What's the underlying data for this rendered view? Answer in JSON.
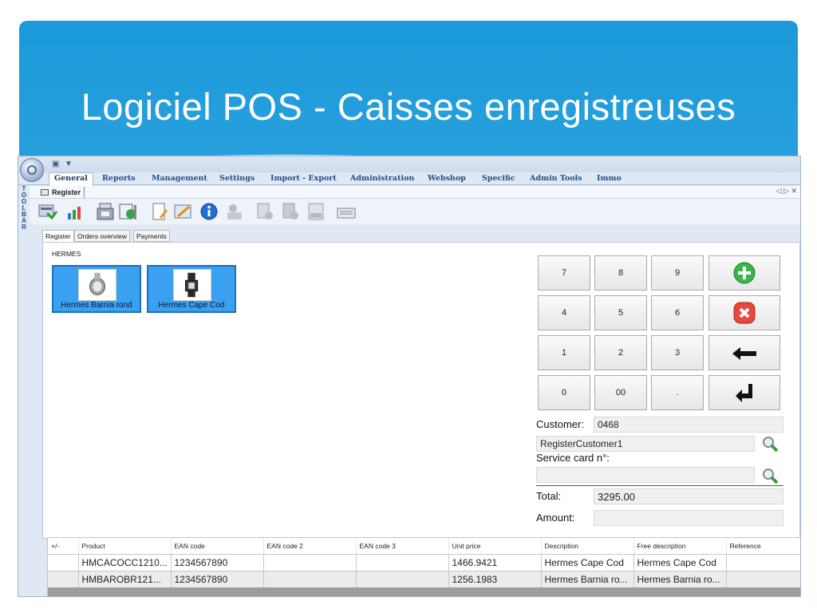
{
  "slide": {
    "title": "Logiciel POS - Caisses enregistreuses"
  },
  "ribbon": {
    "tabs": [
      "General",
      "Reports",
      "Management",
      "Settings",
      "Import - Export",
      "Administration",
      "Webshop",
      "Specific",
      "Admin Tools",
      "Immo"
    ],
    "active_tab": "General"
  },
  "toolbar_side": [
    "T",
    "O",
    "O",
    "L",
    "B",
    "A",
    "R"
  ],
  "document_tab": {
    "label": "Register",
    "controls": "◁ ▷ ✕"
  },
  "icons": [
    "register-icon",
    "stats-icon",
    "cash-register-icon",
    "refresh-report-icon",
    "new-document-icon",
    "edit-icon",
    "info-icon",
    "user-card-icon",
    "add-document-icon",
    "add-book-icon",
    "xlsx-export-icon",
    "keyboard-icon"
  ],
  "inner_tabs": [
    "Register",
    "Orders overview",
    "Payments"
  ],
  "category": "HERMES",
  "products": [
    {
      "label": "Hermes Barnia rond"
    },
    {
      "label": "Hermes Cape Cod"
    }
  ],
  "keypad": {
    "rows": [
      [
        "7",
        "8",
        "9"
      ],
      [
        "4",
        "5",
        "6"
      ],
      [
        "1",
        "2",
        "3"
      ],
      [
        "0",
        "00",
        "."
      ]
    ],
    "actions": [
      "add-icon",
      "cancel-icon",
      "backspace-icon",
      "enter-icon"
    ]
  },
  "customer": {
    "label": "Customer:",
    "number": "0468",
    "name": "RegisterCustomer1",
    "service_card_label": "Service card n°:",
    "service_card_value": ""
  },
  "totals": {
    "total_label": "Total:",
    "total_value": "3295.00",
    "amount_label": "Amount:",
    "amount_value": ""
  },
  "grid": {
    "columns": [
      "+/-",
      "Product",
      "EAN code",
      "EAN code 2",
      "EAN code 3",
      "Unit price",
      "Description",
      "Free description",
      "Reference"
    ],
    "rows": [
      [
        "",
        "HMCACOCC1210...",
        "1234567890",
        "",
        "",
        "1466.9421",
        "Hermes Cape Cod",
        "Hermes Cape Cod",
        ""
      ],
      [
        "",
        "HMBAROBR121...",
        "1234567890",
        "",
        "",
        "1256.1983",
        "Hermes Barnia ro...",
        "Hermes Barnia ro...",
        ""
      ]
    ]
  },
  "colors": {
    "accent": "#1a9ad9",
    "tile": "#3aa0f0",
    "add_green": "#3cb54a",
    "cancel_red": "#e8473c"
  }
}
